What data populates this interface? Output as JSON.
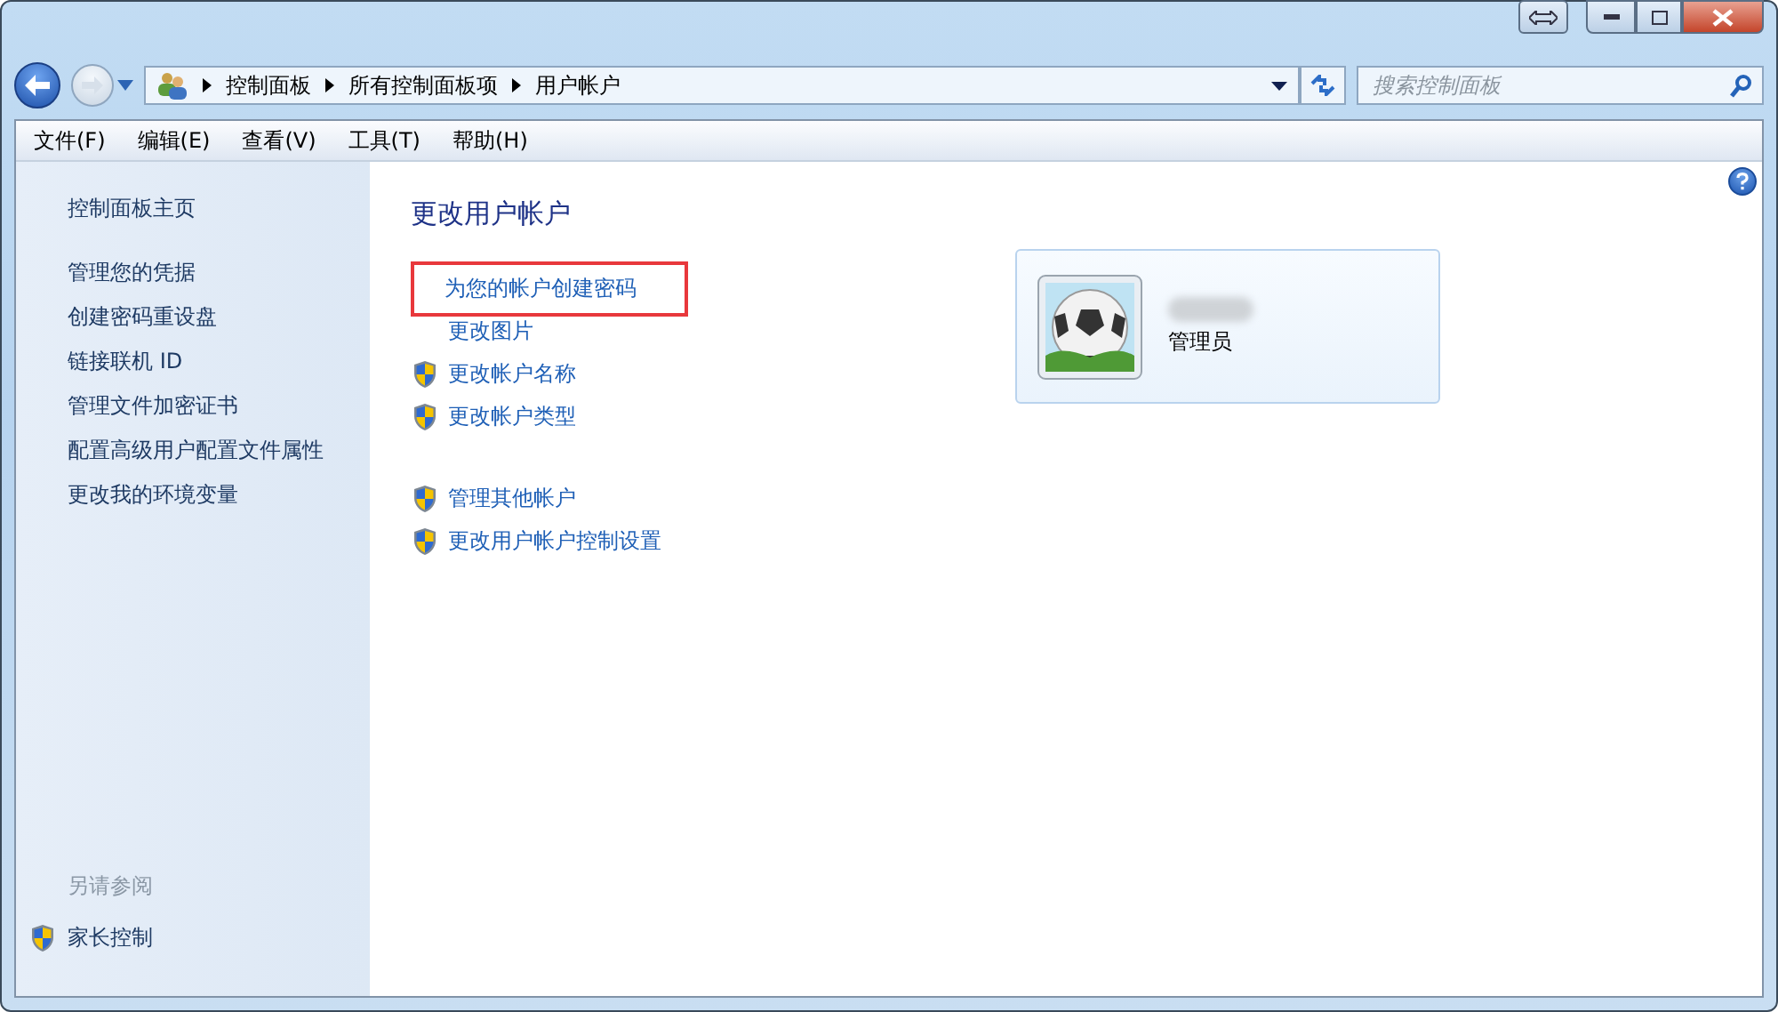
{
  "breadcrumb": [
    "控制面板",
    "所有控制面板项",
    "用户帐户"
  ],
  "search": {
    "placeholder": "搜索控制面板"
  },
  "menu": [
    "文件(F)",
    "编辑(E)",
    "查看(V)",
    "工具(T)",
    "帮助(H)"
  ],
  "sidebar": {
    "sections": [
      [
        "控制面板主页"
      ],
      [
        "管理您的凭据",
        "创建密码重设盘",
        "链接联机 ID",
        "管理文件加密证书",
        "配置高级用户配置文件属性",
        "更改我的环境变量"
      ]
    ],
    "see_also": {
      "heading": "另请参阅",
      "items": [
        {
          "label": "家长控制",
          "shield": true
        }
      ]
    }
  },
  "main": {
    "title": "更改用户帐户",
    "groups": [
      [
        {
          "label": "为您的帐户创建密码",
          "shield": false,
          "highlighted": true
        },
        {
          "label": "更改图片",
          "shield": false,
          "highlighted": false
        },
        {
          "label": "更改帐户名称",
          "shield": true,
          "highlighted": false
        },
        {
          "label": "更改帐户类型",
          "shield": true,
          "highlighted": false
        }
      ],
      [
        {
          "label": "管理其他帐户",
          "shield": true,
          "highlighted": false
        },
        {
          "label": "更改用户帐户控制设置",
          "shield": true,
          "highlighted": false
        }
      ]
    ]
  },
  "account": {
    "role": "管理员",
    "name_redacted": true
  }
}
